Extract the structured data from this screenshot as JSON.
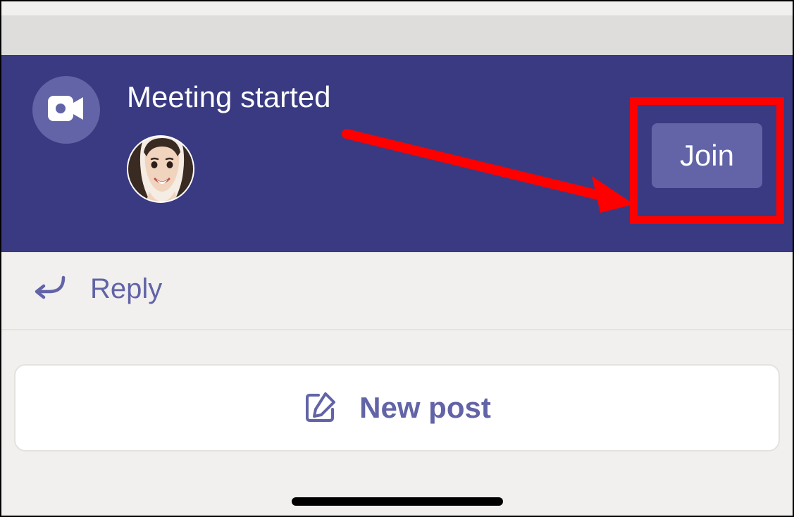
{
  "meeting": {
    "title": "Meeting started",
    "join_label": "Join"
  },
  "reply": {
    "label": "Reply"
  },
  "composer": {
    "new_post_label": "New post"
  }
}
